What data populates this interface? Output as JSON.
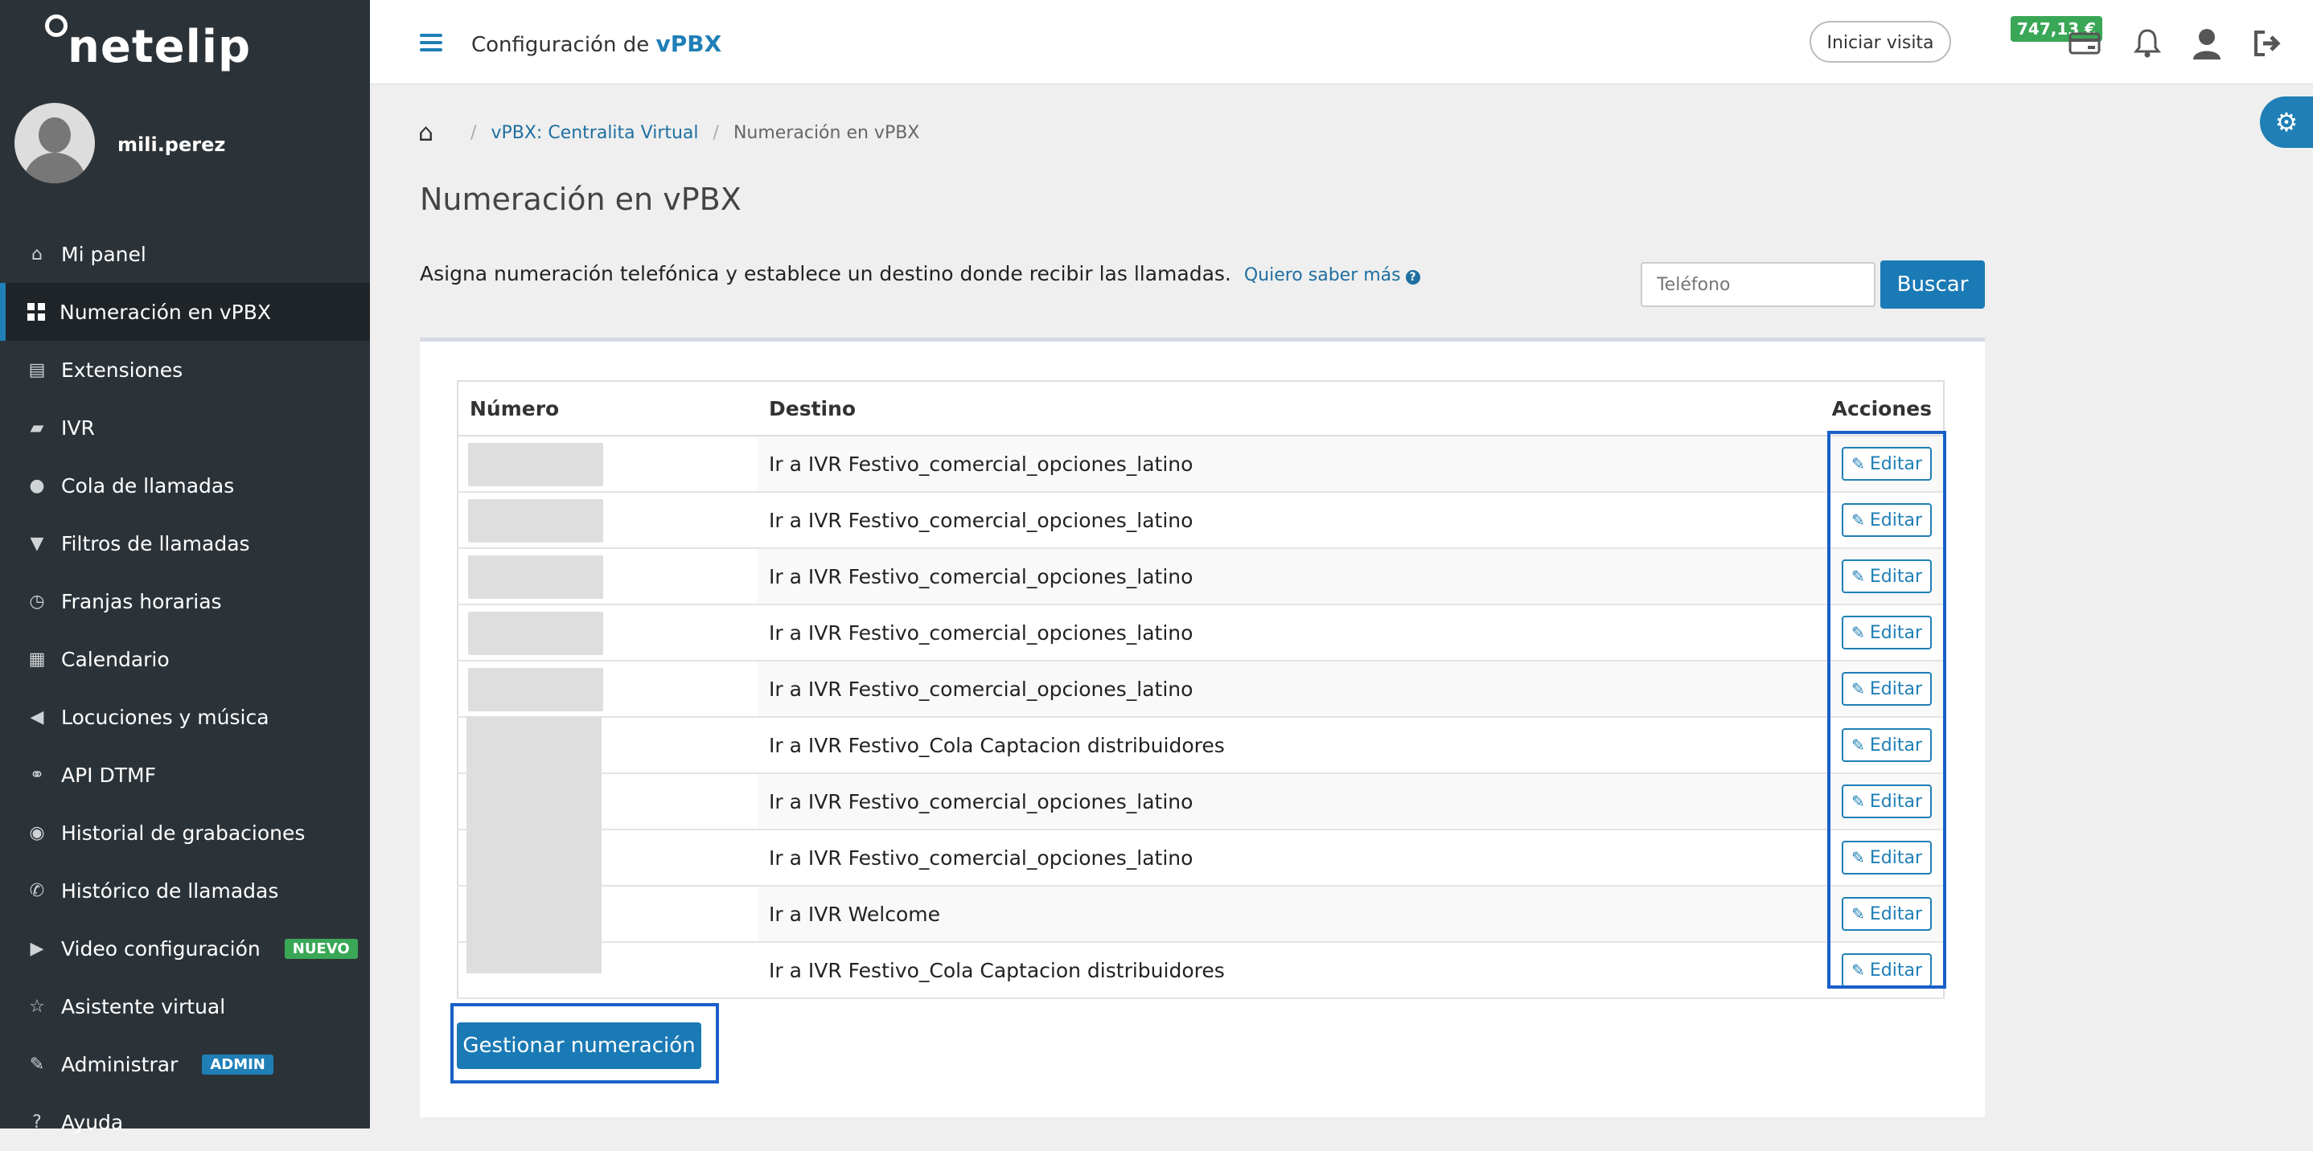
{
  "brand": {
    "logo_text": "netelip"
  },
  "user": {
    "name": "mili.perez"
  },
  "sidebar": {
    "items": [
      {
        "label": "Mi panel",
        "icon": "home-icon",
        "glyph": "⌂"
      },
      {
        "label": "Numeración en vPBX",
        "icon": "grid-icon",
        "glyph": "",
        "active": true
      },
      {
        "label": "Extensiones",
        "icon": "list-icon",
        "glyph": "▤"
      },
      {
        "label": "IVR",
        "icon": "comment-icon",
        "glyph": "▰"
      },
      {
        "label": "Cola de llamadas",
        "icon": "user-icon",
        "glyph": "●"
      },
      {
        "label": "Filtros de llamadas",
        "icon": "filter-icon",
        "glyph": "▼"
      },
      {
        "label": "Franjas horarias",
        "icon": "clock-icon",
        "glyph": "◷"
      },
      {
        "label": "Calendario",
        "icon": "calendar-icon",
        "glyph": "▦"
      },
      {
        "label": "Locuciones y música",
        "icon": "speaker-icon",
        "glyph": "◀"
      },
      {
        "label": "API DTMF",
        "icon": "link-icon",
        "glyph": "⚭"
      },
      {
        "label": "Historial de grabaciones",
        "icon": "record-icon",
        "glyph": "◉"
      },
      {
        "label": "Histórico de llamadas",
        "icon": "phone-icon",
        "glyph": "✆"
      },
      {
        "label": "Video configuración",
        "icon": "video-icon",
        "glyph": "▶",
        "badge": "NUEVO",
        "badge_color": "#3aa757"
      },
      {
        "label": "Asistente virtual",
        "icon": "star-icon",
        "glyph": "☆"
      },
      {
        "label": "Administrar",
        "icon": "edit-icon",
        "glyph": "✎",
        "badge": "ADMIN",
        "badge_color": "#1f7fb6"
      },
      {
        "label": "Ayuda",
        "icon": "question-icon",
        "glyph": "?"
      }
    ]
  },
  "topbar": {
    "title_prefix": "Configuración de",
    "title_bold": "vPBX",
    "visit_label": "Iniciar visita",
    "balance": "747,13 €"
  },
  "breadcrumb": {
    "parent": "vPBX: Centralita Virtual",
    "current": "Numeración en vPBX"
  },
  "page": {
    "title": "Numeración en vPBX",
    "description": "Asigna numeración telefónica y establece un destino donde recibir las llamadas.",
    "more_link": "Quiero saber más"
  },
  "search": {
    "placeholder": "Teléfono",
    "button": "Buscar"
  },
  "table": {
    "headers": {
      "number": "Número",
      "destination": "Destino",
      "actions": "Acciones"
    },
    "edit_label": "Editar",
    "rows": [
      {
        "destination": "Ir a IVR Festivo_comercial_opciones_latino"
      },
      {
        "destination": "Ir a IVR Festivo_comercial_opciones_latino"
      },
      {
        "destination": "Ir a IVR Festivo_comercial_opciones_latino"
      },
      {
        "destination": "Ir a IVR Festivo_comercial_opciones_latino"
      },
      {
        "destination": "Ir a IVR Festivo_comercial_opciones_latino"
      },
      {
        "destination": "Ir a IVR Festivo_Cola Captacion distribuidores"
      },
      {
        "destination": "Ir a IVR Festivo_comercial_opciones_latino"
      },
      {
        "destination": "Ir a IVR Festivo_comercial_opciones_latino"
      },
      {
        "destination": "Ir a IVR Welcome"
      },
      {
        "destination": "Ir a IVR Festivo_Cola Captacion distribuidores"
      }
    ]
  },
  "manage_button": "Gestionar numeración",
  "colors": {
    "primary": "#1a7ab5",
    "sidebar": "#2c3338",
    "success": "#3aa757",
    "highlight": "#1a5fc8"
  }
}
